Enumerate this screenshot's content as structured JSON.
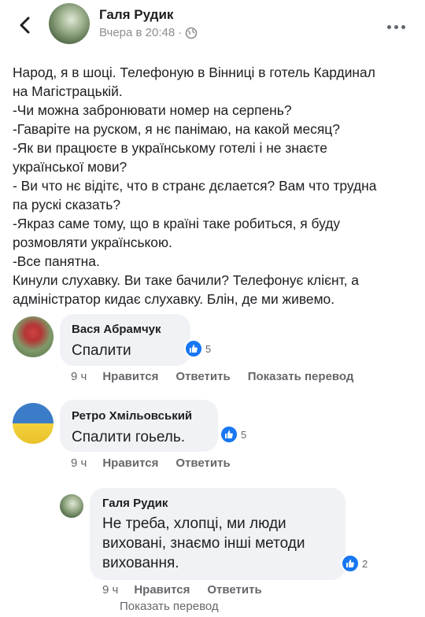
{
  "header": {
    "author": "Галя Рудик",
    "time": "Вчера в 20:48",
    "dot": "·"
  },
  "post": {
    "lines": [
      "Народ, я в шоці. Телефоную в Вінниці в готель Кардинал",
      "на Магістрацькій.",
      "-Чи можна забронювати номер на серпень?",
      "-Гаваріте на руском, я нє панімаю, на какой месяц?",
      "-Як ви працюєте в українському готелі і не знаєте",
      "української мови?",
      "- Ви что нє відітє, что в странє дєлается? Вам что трудна",
      "па рускі сказать?",
      "-Якраз саме тому, що в країні таке робиться, я буду",
      "розмовляти українською.",
      "-Все панятна.",
      "Кинули слухавку. Ви таке бачили? Телефонує клієнт, а",
      "адміністратор кидає слухавку. Блін, де ми живемо."
    ]
  },
  "comments": [
    {
      "name": "Вася Абрамчук",
      "text": "Спалити",
      "reactions": "5",
      "time": "9 ч",
      "like": "Нравится",
      "reply": "Ответить",
      "translate": "Показать перевод"
    },
    {
      "name": "Ретро Хмільовський",
      "text": "Спалити гоьель.",
      "reactions": "5",
      "time": "9 ч",
      "like": "Нравится",
      "reply": "Ответить"
    }
  ],
  "reply": {
    "name": "Галя Рудик",
    "lines": [
      "Не треба, хлопці, ми люди",
      "виховані, знаємо інші методи",
      "виховання."
    ],
    "reactions": "2",
    "time": "9 ч",
    "like": "Нравится",
    "reply": "Ответить",
    "translate": "Показать перевод"
  },
  "icons": {
    "back": "chevron-left-icon",
    "globe": "globe-icon",
    "more": "more-dots-icon",
    "like": "thumbs-up-icon"
  },
  "colors": {
    "accent": "#1877f2",
    "bubble": "#f0f2f5",
    "muted": "#65676b"
  }
}
